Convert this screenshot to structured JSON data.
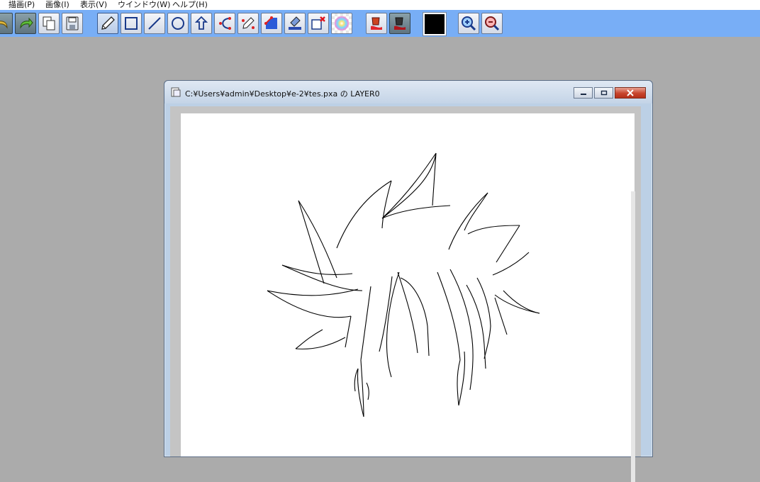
{
  "menu": {
    "items": [
      "描画(P)",
      "画像(I)",
      "表示(V)",
      "ウインドウ(W)",
      "ヘルプ(H)"
    ]
  },
  "toolbar": {
    "tools": [
      {
        "icon": "undo-icon",
        "name": "undo"
      },
      {
        "icon": "redo-icon",
        "name": "redo"
      },
      {
        "icon": "copy-icon",
        "name": "copy"
      },
      {
        "icon": "save-icon",
        "name": "save"
      },
      {
        "icon": "pen-icon",
        "name": "pen",
        "active": true
      },
      {
        "icon": "rectangle-icon",
        "name": "rectangle"
      },
      {
        "icon": "line-icon",
        "name": "line"
      },
      {
        "icon": "ellipse-icon",
        "name": "ellipse"
      },
      {
        "icon": "polygon-icon",
        "name": "polygon"
      },
      {
        "icon": "curve-icon",
        "name": "curve"
      },
      {
        "icon": "pen-curve-icon",
        "name": "pen-curve"
      },
      {
        "icon": "fill-area-icon",
        "name": "fill-area"
      },
      {
        "icon": "stamp-icon",
        "name": "stamp"
      },
      {
        "icon": "new-layer-icon",
        "name": "new-layer"
      },
      {
        "icon": "transparency-icon",
        "name": "transparency"
      },
      {
        "icon": "paint-bucket-red-icon",
        "name": "paint-bucket-red"
      },
      {
        "icon": "paint-bucket-dark-icon",
        "name": "paint-bucket-dark"
      }
    ],
    "current_color": "#000000",
    "zoom": [
      {
        "icon": "zoom-in-icon",
        "name": "zoom-in"
      },
      {
        "icon": "zoom-out-icon",
        "name": "zoom-out"
      }
    ]
  },
  "document_window": {
    "title": "C:¥Users¥admin¥Desktop¥e-2¥tes.pxa の LAYER0"
  },
  "colors": {
    "workspace": "#ababab",
    "toolbar": "#78aef6",
    "stroke": "#000000"
  }
}
